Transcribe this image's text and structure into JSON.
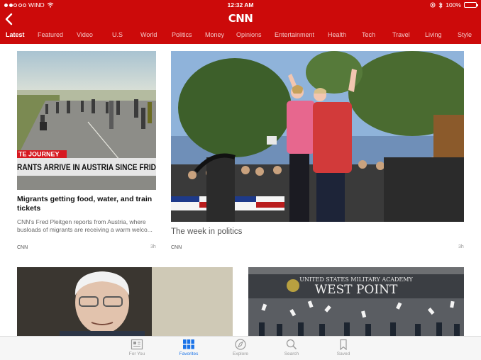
{
  "status_bar": {
    "carrier": "WIND",
    "time": "12:32 AM",
    "battery": "100%",
    "battery_level": 1.0
  },
  "header": {
    "logo": "CNN",
    "back_icon": "chevron-left-icon"
  },
  "tabs": [
    {
      "label": "Latest",
      "active": true
    },
    {
      "label": "Featured"
    },
    {
      "label": "Video"
    },
    {
      "label": "U.S"
    },
    {
      "label": "World"
    },
    {
      "label": "Politics"
    },
    {
      "label": "Money"
    },
    {
      "label": "Opinions"
    },
    {
      "label": "Entertainment"
    },
    {
      "label": "Health"
    },
    {
      "label": "Tech"
    },
    {
      "label": "Travel"
    },
    {
      "label": "Living"
    },
    {
      "label": "Style"
    }
  ],
  "articles": [
    {
      "banner_top": "TE JOURNEY",
      "banner_bottom": "RANTS ARRIVE IN AUSTRIA SINCE FRID",
      "title": "Migrants getting food, water, and train tickets",
      "description": "CNN's Fred Pleitgen reports from Austria, where busloads of migrants are receiving a warm welco...",
      "source": "CNN",
      "age": "3h"
    },
    {
      "title": "The week in politics",
      "source": "CNN",
      "age": "3h"
    },
    {
      "sign_line1": "UNITED STATES MILITARY ACADEMY",
      "sign_line2": "WEST POINT"
    }
  ],
  "tabbar": [
    {
      "label": "For You",
      "icon": "newspaper-icon"
    },
    {
      "label": "Favorites",
      "icon": "grid-icon",
      "active": true
    },
    {
      "label": "Explore",
      "icon": "compass-icon"
    },
    {
      "label": "Search",
      "icon": "search-icon"
    },
    {
      "label": "Saved",
      "icon": "bookmark-icon"
    }
  ],
  "colors": {
    "brand_red": "#cc0a0a",
    "active_tab": "#1a73e8"
  }
}
